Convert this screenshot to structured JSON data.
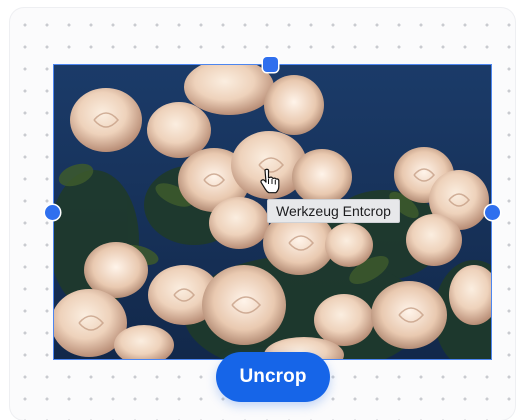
{
  "crop_tool": {
    "tooltip": "Werkzeug Entcrop",
    "uncrop_label": "Uncrop"
  },
  "colors": {
    "accent": "#1665e8",
    "handle": "#2f6fee",
    "selection_border": "#4d86f0",
    "photo_sky": "#17345f",
    "flower_petal": "#f2dcc8"
  },
  "icons": {
    "cursor": "hand-pointer-icon"
  },
  "image": {
    "subject": "white roses"
  }
}
